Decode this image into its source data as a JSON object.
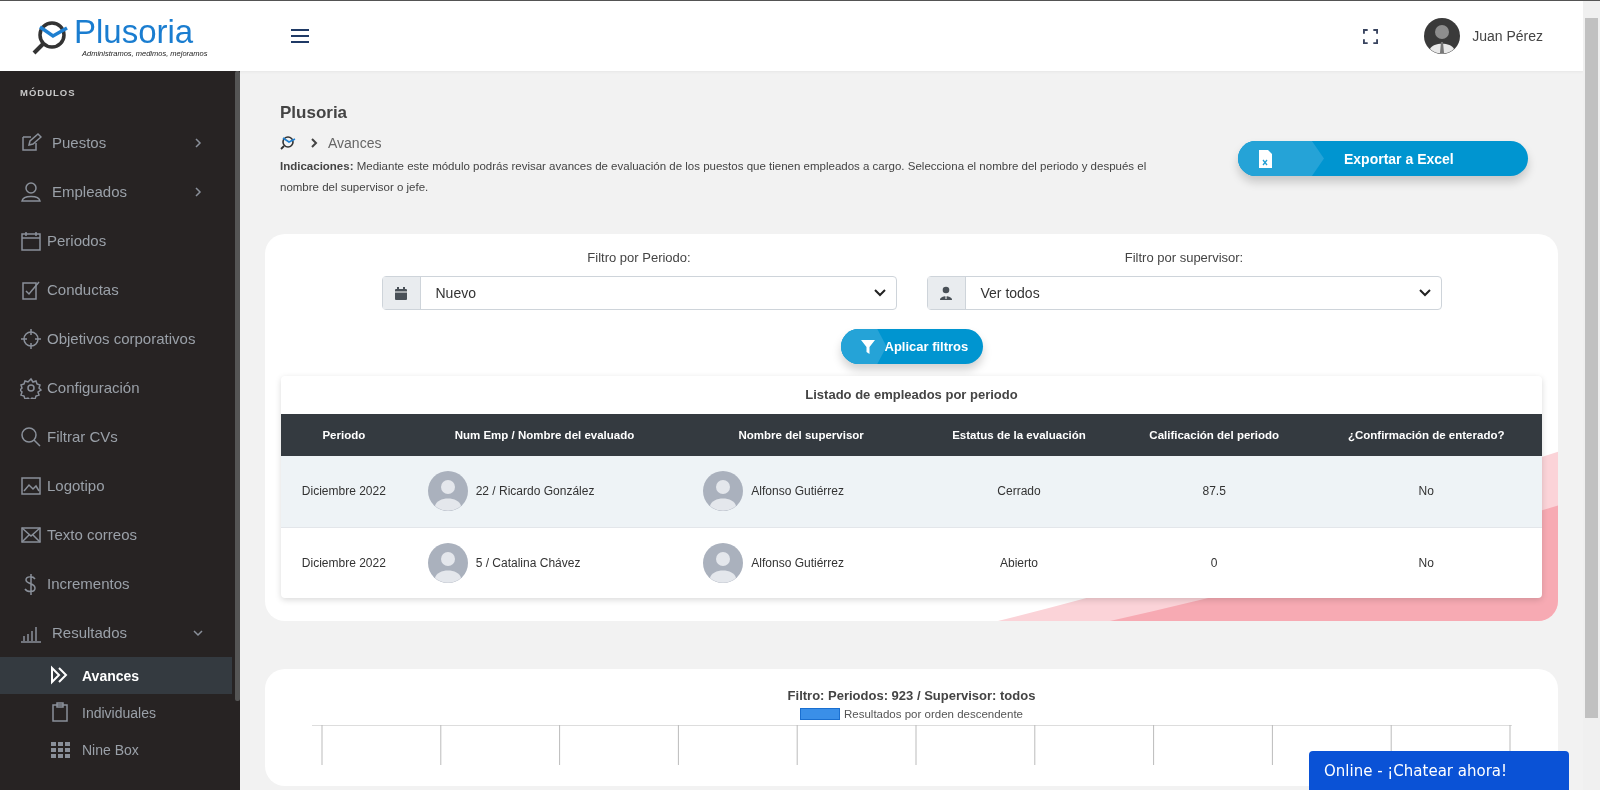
{
  "header": {
    "logo_text": "Plusoria",
    "logo_tagline": "Administramos, medimos, mejoramos",
    "user_name": "Juan Pérez"
  },
  "sidebar": {
    "heading": "MÓDULOS",
    "items": [
      {
        "label": "Puestos",
        "expandable": true,
        "expanded": false
      },
      {
        "label": "Empleados",
        "expandable": true,
        "expanded": false
      },
      {
        "label": "Periodos",
        "expandable": false
      },
      {
        "label": "Conductas",
        "expandable": false
      },
      {
        "label": "Objetivos corporativos",
        "expandable": false
      },
      {
        "label": "Configuración",
        "expandable": false
      },
      {
        "label": "Filtrar CVs",
        "expandable": false
      },
      {
        "label": "Logotipo",
        "expandable": false
      },
      {
        "label": "Texto correos",
        "expandable": false
      },
      {
        "label": "Incrementos",
        "expandable": false
      },
      {
        "label": "Resultados",
        "expandable": true,
        "expanded": true,
        "children": [
          {
            "label": "Avances",
            "selected": true
          },
          {
            "label": "Individuales",
            "selected": false
          },
          {
            "label": "Nine Box",
            "selected": false
          }
        ]
      }
    ]
  },
  "page": {
    "title": "Plusoria",
    "breadcrumb": "Avances",
    "instructions": "**Indicaciones:** Mediante este módulo podrás revisar avances de evaluación de los puestos que tienen empleados a cargo. Selecciona el nombre del periodo y después el nombre del supervisor o jefe.",
    "export_button": "Exportar a Excel"
  },
  "filters": [
    {
      "label": "Filtro por Periodo:",
      "value": "Nuevo"
    },
    {
      "label": "Filtro por supervisor:",
      "value": "Ver todos"
    }
  ],
  "apply_button": "Aplicar filtros",
  "table": {
    "title": "Listado de empleados por periodo",
    "columns": [
      "Periodo",
      "Num Emp / Nombre del evaluado",
      "Nombre del supervisor",
      "Estatus de la evaluación",
      "Calificación del periodo",
      "¿Confirmación de enterado?"
    ],
    "rows": [
      {
        "period": "Diciembre 2022",
        "employee": "22 / Ricardo González",
        "supervisor": "Alfonso Gutiérrez",
        "status": "Cerrado",
        "score": "87.5",
        "confirmed": "No",
        "highlighted": true
      },
      {
        "period": "Diciembre 2022",
        "employee": "5 / Catalina Chávez",
        "supervisor": "Alfonso Gutiérrez",
        "status": "Abierto",
        "score": "0",
        "confirmed": "No",
        "highlighted": false
      }
    ]
  },
  "chart": {
    "title": "Filtro: Periodos: 923 / Supervisor: todos",
    "legend": "Resultados por orden descendente"
  },
  "chat_button": "Online - ¡Chatear ahora!"
}
